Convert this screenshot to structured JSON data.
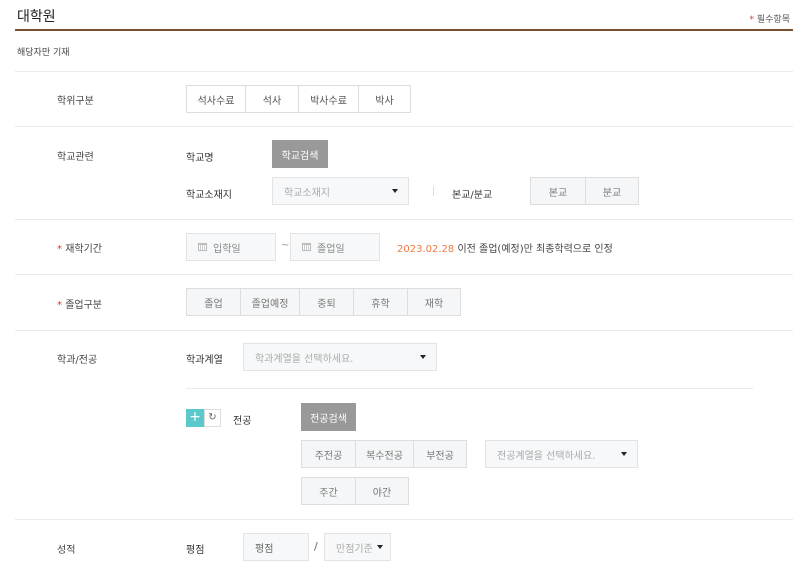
{
  "header": {
    "title": "대학원",
    "required_star": "*",
    "required_label": "필수항목",
    "note": "해당자만 기재"
  },
  "degree": {
    "label": "학위구분",
    "options": [
      "석사수료",
      "석사",
      "박사수료",
      "박사"
    ]
  },
  "school": {
    "label": "학교관련",
    "name_label": "학교명",
    "search_btn": "학교검색",
    "location_label": "학교소재지",
    "location_placeholder": "학교소재지",
    "campus_label": "본교/분교",
    "campus_options": [
      "본교",
      "분교"
    ]
  },
  "period": {
    "star": "*",
    "label": "재학기간",
    "start_placeholder": "입학일",
    "tilde": "~",
    "end_placeholder": "졸업일",
    "notice_date": "2023.02.28",
    "notice_text": " 이전 졸업(예정)만 최종학력으로 인정"
  },
  "graduation": {
    "star": "*",
    "label": "졸업구분",
    "options": [
      "졸업",
      "졸업예정",
      "중퇴",
      "휴학",
      "재학"
    ]
  },
  "major": {
    "label": "학과/전공",
    "field_label": "학과계열",
    "field_placeholder": "학과계열을 선택하세요.",
    "major_label": "전공",
    "search_btn": "전공검색",
    "type_options": [
      "주전공",
      "복수전공",
      "부전공"
    ],
    "major_field_placeholder": "전공계열을 선택하세요.",
    "time_options": [
      "주간",
      "야간"
    ]
  },
  "grade": {
    "label": "성적",
    "gpa_label": "평점",
    "gpa_placeholder": "평점",
    "slash": "/",
    "max_placeholder": "만점기준"
  },
  "colors": {
    "accent_line": "#7a4f2d",
    "notice": "#f07b45",
    "add_button": "#5bc8cc"
  }
}
